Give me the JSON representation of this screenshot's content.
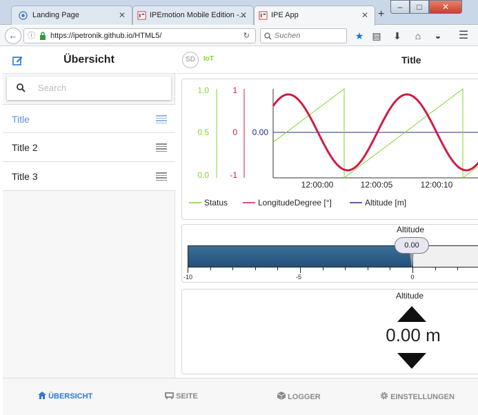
{
  "browser": {
    "tabs": [
      {
        "label": "Landing Page",
        "active": false
      },
      {
        "label": "IPEmotion Mobile Edition -...",
        "active": false
      },
      {
        "label": "IPE App",
        "active": true
      }
    ],
    "new_tab": "+",
    "url": "https://ipetronik.github.io/HTML5/",
    "search_placeholder": "Suchen",
    "win_min": "–",
    "win_max": "□",
    "win_close": "✕"
  },
  "sidebar": {
    "title": "Übersicht",
    "search_placeholder": "Search",
    "items": [
      {
        "label": "Title",
        "active": true
      },
      {
        "label": "Title 2",
        "active": false
      },
      {
        "label": "Title 3",
        "active": false
      }
    ]
  },
  "header": {
    "logo": "SD",
    "iot": "IoT",
    "title": "Title"
  },
  "chart_data": {
    "type": "line",
    "x_ticks": [
      "12:00:00",
      "12:00:05",
      "12:00:10"
    ],
    "axes": [
      {
        "name": "Status",
        "ticks": [
          "1.0",
          "0.5",
          "0.0"
        ],
        "color": "#7fd62e",
        "range": [
          0,
          1
        ]
      },
      {
        "name": "LongitudeDegree [°]",
        "ticks": [
          "1",
          "0",
          "-1"
        ],
        "color": "#d11a45",
        "range": [
          -1,
          1
        ]
      },
      {
        "name": "Altitude [m]",
        "ticks": [
          "0.00"
        ],
        "color": "#1f2a8c"
      }
    ],
    "series": [
      {
        "name": "Status",
        "color": "#7fd62e"
      },
      {
        "name": "LongitudeDegree [°]",
        "color": "#d11a45"
      },
      {
        "name": "Altitude [m]",
        "color": "#1f2a8c"
      }
    ],
    "legend": "bottom"
  },
  "gauge": {
    "title": "Altitude",
    "value": "0.00",
    "value_num": 0,
    "min": -10,
    "max": 10,
    "ticks": [
      "-10",
      "-5",
      "0"
    ]
  },
  "display": {
    "title": "Altitude",
    "value": "0.00 m"
  },
  "bottom_nav": [
    {
      "label": "ÜBERSICHT",
      "active": true
    },
    {
      "label": "SEITE",
      "active": false
    },
    {
      "label": "LOGGER",
      "active": false
    },
    {
      "label": "EINSTELLUNGEN",
      "active": false
    }
  ],
  "colors": {
    "accent": "#2e76d6",
    "bar": "#2f5f86",
    "status": "#7fd62e",
    "longitude": "#d11a45",
    "altitude": "#1f2a8c"
  }
}
